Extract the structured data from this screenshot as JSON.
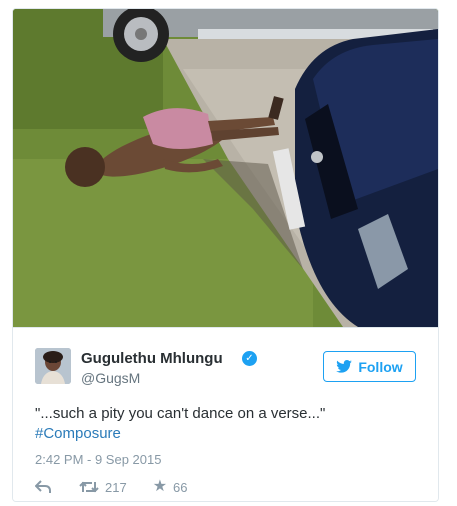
{
  "tweet": {
    "author_name": "Gugulethu Mhlungu",
    "handle": "@GugsM",
    "verified": true,
    "text": "\"...such a pity you can't dance on a verse...\"",
    "hashtag": "#Composure",
    "timestamp": "2:42 PM - 9 Sep 2015",
    "follow_label": "Follow",
    "retweets": "217",
    "likes": "66"
  },
  "icons": {
    "verified": "verified-badge-icon",
    "follow": "twitter-bird-icon",
    "reply": "reply-icon",
    "retweet": "retweet-icon",
    "like": "star-icon"
  },
  "colors": {
    "accent": "#1da1f2",
    "hashtag": "#2b7bb9",
    "muted": "#8899a6",
    "text": "#292f33"
  }
}
